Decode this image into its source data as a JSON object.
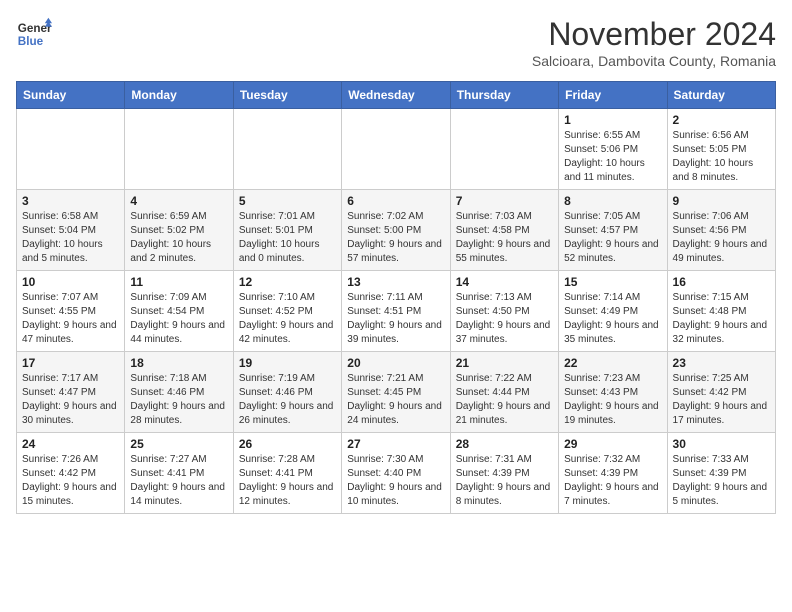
{
  "logo": {
    "line1": "General",
    "line2": "Blue"
  },
  "title": "November 2024",
  "subtitle": "Salcioara, Dambovita County, Romania",
  "weekdays": [
    "Sunday",
    "Monday",
    "Tuesday",
    "Wednesday",
    "Thursday",
    "Friday",
    "Saturday"
  ],
  "weeks": [
    [
      {
        "day": "",
        "info": ""
      },
      {
        "day": "",
        "info": ""
      },
      {
        "day": "",
        "info": ""
      },
      {
        "day": "",
        "info": ""
      },
      {
        "day": "",
        "info": ""
      },
      {
        "day": "1",
        "info": "Sunrise: 6:55 AM\nSunset: 5:06 PM\nDaylight: 10 hours and 11 minutes."
      },
      {
        "day": "2",
        "info": "Sunrise: 6:56 AM\nSunset: 5:05 PM\nDaylight: 10 hours and 8 minutes."
      }
    ],
    [
      {
        "day": "3",
        "info": "Sunrise: 6:58 AM\nSunset: 5:04 PM\nDaylight: 10 hours and 5 minutes."
      },
      {
        "day": "4",
        "info": "Sunrise: 6:59 AM\nSunset: 5:02 PM\nDaylight: 10 hours and 2 minutes."
      },
      {
        "day": "5",
        "info": "Sunrise: 7:01 AM\nSunset: 5:01 PM\nDaylight: 10 hours and 0 minutes."
      },
      {
        "day": "6",
        "info": "Sunrise: 7:02 AM\nSunset: 5:00 PM\nDaylight: 9 hours and 57 minutes."
      },
      {
        "day": "7",
        "info": "Sunrise: 7:03 AM\nSunset: 4:58 PM\nDaylight: 9 hours and 55 minutes."
      },
      {
        "day": "8",
        "info": "Sunrise: 7:05 AM\nSunset: 4:57 PM\nDaylight: 9 hours and 52 minutes."
      },
      {
        "day": "9",
        "info": "Sunrise: 7:06 AM\nSunset: 4:56 PM\nDaylight: 9 hours and 49 minutes."
      }
    ],
    [
      {
        "day": "10",
        "info": "Sunrise: 7:07 AM\nSunset: 4:55 PM\nDaylight: 9 hours and 47 minutes."
      },
      {
        "day": "11",
        "info": "Sunrise: 7:09 AM\nSunset: 4:54 PM\nDaylight: 9 hours and 44 minutes."
      },
      {
        "day": "12",
        "info": "Sunrise: 7:10 AM\nSunset: 4:52 PM\nDaylight: 9 hours and 42 minutes."
      },
      {
        "day": "13",
        "info": "Sunrise: 7:11 AM\nSunset: 4:51 PM\nDaylight: 9 hours and 39 minutes."
      },
      {
        "day": "14",
        "info": "Sunrise: 7:13 AM\nSunset: 4:50 PM\nDaylight: 9 hours and 37 minutes."
      },
      {
        "day": "15",
        "info": "Sunrise: 7:14 AM\nSunset: 4:49 PM\nDaylight: 9 hours and 35 minutes."
      },
      {
        "day": "16",
        "info": "Sunrise: 7:15 AM\nSunset: 4:48 PM\nDaylight: 9 hours and 32 minutes."
      }
    ],
    [
      {
        "day": "17",
        "info": "Sunrise: 7:17 AM\nSunset: 4:47 PM\nDaylight: 9 hours and 30 minutes."
      },
      {
        "day": "18",
        "info": "Sunrise: 7:18 AM\nSunset: 4:46 PM\nDaylight: 9 hours and 28 minutes."
      },
      {
        "day": "19",
        "info": "Sunrise: 7:19 AM\nSunset: 4:46 PM\nDaylight: 9 hours and 26 minutes."
      },
      {
        "day": "20",
        "info": "Sunrise: 7:21 AM\nSunset: 4:45 PM\nDaylight: 9 hours and 24 minutes."
      },
      {
        "day": "21",
        "info": "Sunrise: 7:22 AM\nSunset: 4:44 PM\nDaylight: 9 hours and 21 minutes."
      },
      {
        "day": "22",
        "info": "Sunrise: 7:23 AM\nSunset: 4:43 PM\nDaylight: 9 hours and 19 minutes."
      },
      {
        "day": "23",
        "info": "Sunrise: 7:25 AM\nSunset: 4:42 PM\nDaylight: 9 hours and 17 minutes."
      }
    ],
    [
      {
        "day": "24",
        "info": "Sunrise: 7:26 AM\nSunset: 4:42 PM\nDaylight: 9 hours and 15 minutes."
      },
      {
        "day": "25",
        "info": "Sunrise: 7:27 AM\nSunset: 4:41 PM\nDaylight: 9 hours and 14 minutes."
      },
      {
        "day": "26",
        "info": "Sunrise: 7:28 AM\nSunset: 4:41 PM\nDaylight: 9 hours and 12 minutes."
      },
      {
        "day": "27",
        "info": "Sunrise: 7:30 AM\nSunset: 4:40 PM\nDaylight: 9 hours and 10 minutes."
      },
      {
        "day": "28",
        "info": "Sunrise: 7:31 AM\nSunset: 4:39 PM\nDaylight: 9 hours and 8 minutes."
      },
      {
        "day": "29",
        "info": "Sunrise: 7:32 AM\nSunset: 4:39 PM\nDaylight: 9 hours and 7 minutes."
      },
      {
        "day": "30",
        "info": "Sunrise: 7:33 AM\nSunset: 4:39 PM\nDaylight: 9 hours and 5 minutes."
      }
    ]
  ]
}
